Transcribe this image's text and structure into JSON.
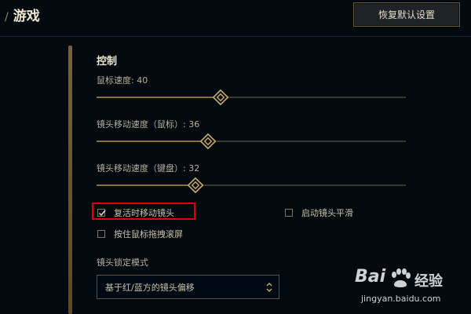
{
  "header": {
    "separator": "/",
    "title": "游戏",
    "reset_label": "恢复默认设置"
  },
  "controls": {
    "section_title": "控制",
    "sliders": [
      {
        "label": "鼠标速度: 40",
        "value": 40,
        "max": 100
      },
      {
        "label": "镜头移动速度（鼠标）: 36",
        "value": 36,
        "max": 100
      },
      {
        "label": "镜头移动速度（键盘）: 32",
        "value": 32,
        "max": 100
      }
    ],
    "checkboxes": [
      {
        "label": "复活时移动镜头",
        "checked": true
      },
      {
        "label": "启动镜头平滑",
        "checked": false
      },
      {
        "label": "按住鼠标拖拽滚屏",
        "checked": false
      }
    ],
    "lock_mode": {
      "label": "镜头锁定模式",
      "selected": "基于红/蓝方的镜头偏移"
    }
  },
  "watermark": {
    "brand": "Bai",
    "brand_cn": "经验",
    "url": "jingyan.baidu.com"
  },
  "colors": {
    "background": "#020a10",
    "gold": "#c8aa6e",
    "highlight": "#e00000"
  }
}
